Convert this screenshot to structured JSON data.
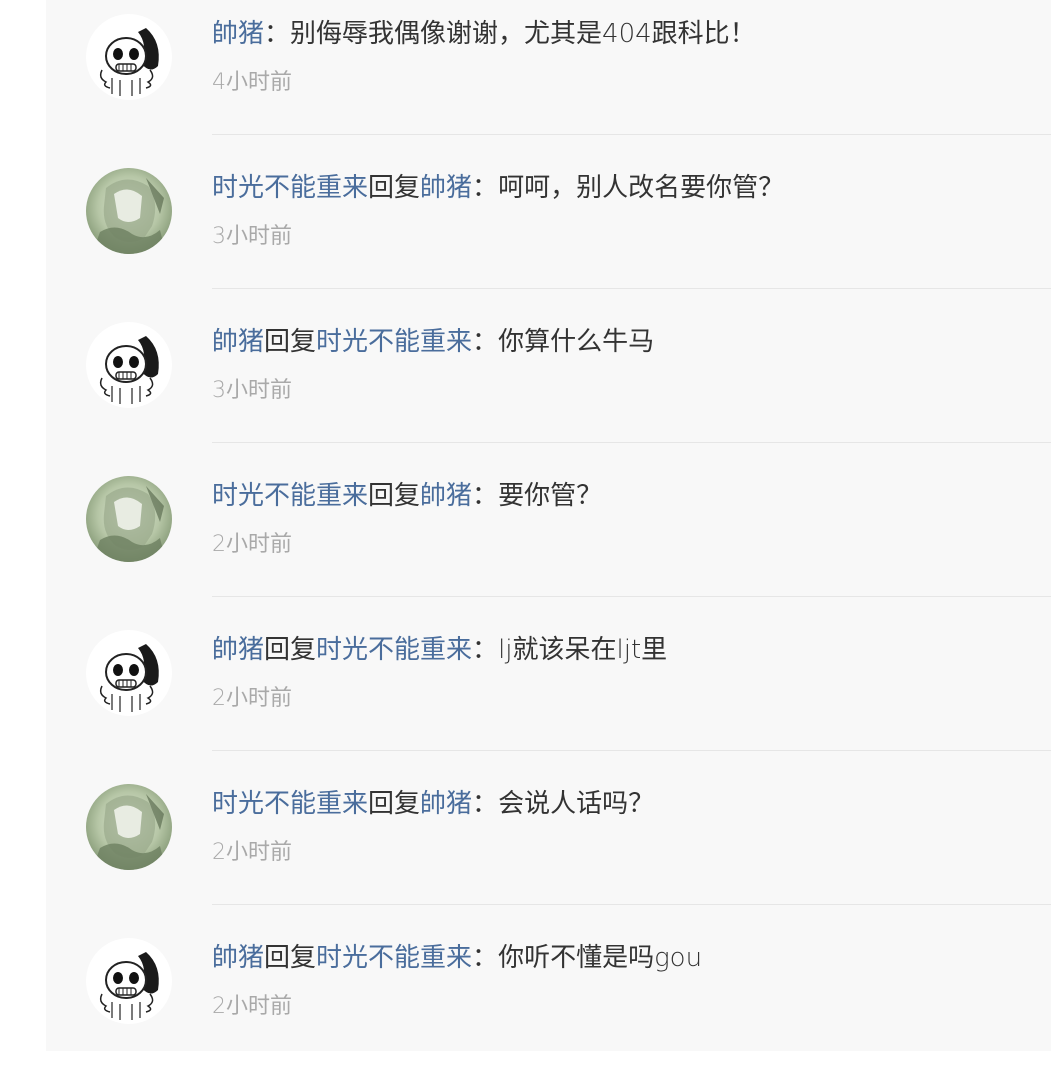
{
  "comments": [
    {
      "avatar": "skull-avatar",
      "author": "帥猪",
      "reply_word": "",
      "reply_to": "",
      "sep": "：",
      "text": "别侮辱我偶像谢谢，尤其是404跟科比！",
      "time": "4小时前"
    },
    {
      "avatar": "photo-avatar",
      "author": "时光不能重来",
      "reply_word": "回复",
      "reply_to": "帥猪",
      "sep": "：",
      "text": "呵呵，别人改名要你管？",
      "time": "3小时前"
    },
    {
      "avatar": "skull-avatar",
      "author": "帥猪",
      "reply_word": "回复",
      "reply_to": "时光不能重来",
      "sep": "：",
      "text": "你算什么牛马",
      "time": "3小时前"
    },
    {
      "avatar": "photo-avatar",
      "author": "时光不能重来",
      "reply_word": "回复",
      "reply_to": "帥猪",
      "sep": "：",
      "text": "要你管？",
      "time": "2小时前"
    },
    {
      "avatar": "skull-avatar",
      "author": "帥猪",
      "reply_word": "回复",
      "reply_to": "时光不能重来",
      "sep": "：",
      "text": "lj就该呆在ljt里",
      "time": "2小时前"
    },
    {
      "avatar": "photo-avatar",
      "author": "时光不能重来",
      "reply_word": "回复",
      "reply_to": "帥猪",
      "sep": "：",
      "text": "会说人话吗？",
      "time": "2小时前"
    },
    {
      "avatar": "skull-avatar",
      "author": "帥猪",
      "reply_word": "回复",
      "reply_to": "时光不能重来",
      "sep": "：",
      "text": "你听不懂是吗gou",
      "time": "2小时前"
    }
  ],
  "colors": {
    "username": "#4a6d9c",
    "text": "#333333",
    "timestamp": "#a9a9a9",
    "panel_background": "#f8f8f8",
    "divider": "#e6e6e6"
  }
}
